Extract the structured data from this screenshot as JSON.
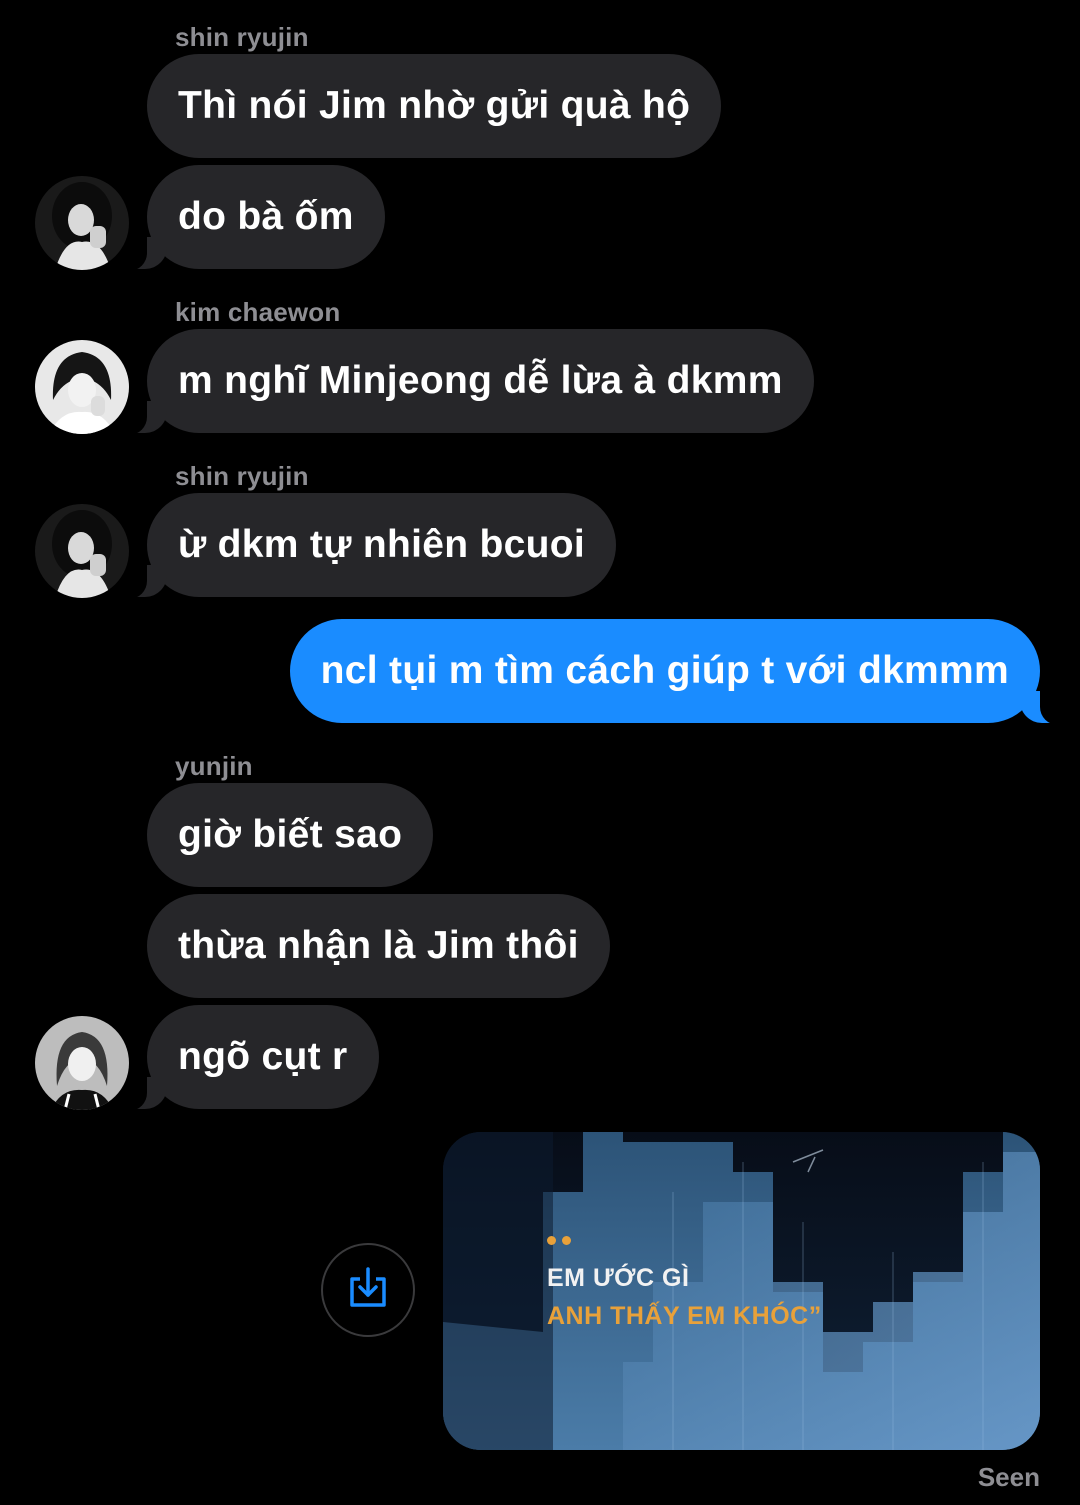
{
  "messages": [
    {
      "sender": "shin ryujin",
      "text": "Thì nói Jim nhờ gửi quà hộ"
    },
    {
      "text": "do bà ốm"
    },
    {
      "sender": "kim chaewon",
      "text": "m nghĩ Minjeong dễ lừa à dkmm"
    },
    {
      "sender": "shin ryujin",
      "text": "ừ dkm tự nhiên bcuoi"
    },
    {
      "text": "ncl tụi m tìm cách giúp t với dkmmm"
    },
    {
      "sender": "yunjin",
      "text": "giờ biết sao"
    },
    {
      "text": "thừa nhận là Jim thôi"
    },
    {
      "text": "ngõ cụt r"
    }
  ],
  "media": {
    "caption_line1": "EM ƯỚC GÌ",
    "caption_line2": "ANH THẤY EM KHÓC”",
    "accent_color": "#e8a13a"
  },
  "share_icon": "share-download-icon",
  "status": "Seen",
  "colors": {
    "background": "#000000",
    "incoming_bubble": "#262629",
    "outgoing_bubble": "#1a8cff",
    "sender_name": "#8e8e93"
  }
}
